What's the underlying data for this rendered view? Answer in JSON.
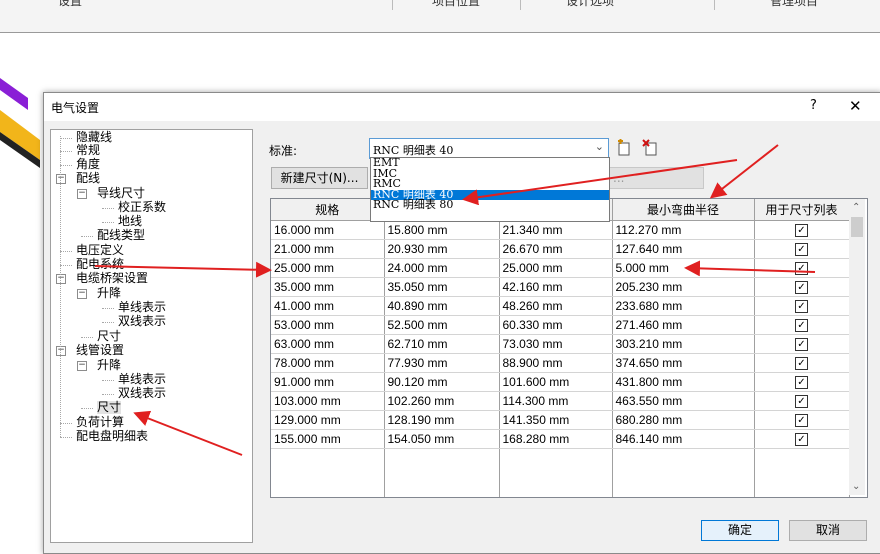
{
  "top_tabs": [
    "设置",
    "项目位置",
    "设计选项",
    "管理项目"
  ],
  "dialog": {
    "title": "电气设置",
    "help_label": "?",
    "close_label": "✕",
    "tree": [
      {
        "label": "隐藏线",
        "toggle": ""
      },
      {
        "label": "常规",
        "toggle": ""
      },
      {
        "label": "角度",
        "toggle": ""
      },
      {
        "label": "配线",
        "toggle": "−"
      },
      {
        "label": "导线尺寸",
        "toggle": "−"
      },
      {
        "label": "校正系数",
        "toggle": ""
      },
      {
        "label": "地线",
        "toggle": ""
      },
      {
        "label": "配线类型",
        "toggle": ""
      },
      {
        "label": "电压定义",
        "toggle": ""
      },
      {
        "label": "配电系统",
        "toggle": ""
      },
      {
        "label": "电缆桥架设置",
        "toggle": "−"
      },
      {
        "label": "升降",
        "toggle": "−"
      },
      {
        "label": "单线表示",
        "toggle": ""
      },
      {
        "label": "双线表示",
        "toggle": ""
      },
      {
        "label": "尺寸",
        "toggle": ""
      },
      {
        "label": "线管设置",
        "toggle": "−"
      },
      {
        "label": "升降",
        "toggle": "−"
      },
      {
        "label": "单线表示",
        "toggle": ""
      },
      {
        "label": "双线表示",
        "toggle": ""
      },
      {
        "label": "尺寸",
        "toggle": "",
        "selected": true
      },
      {
        "label": "负荷计算",
        "toggle": ""
      },
      {
        "label": "配电盘明细表",
        "toggle": ""
      }
    ],
    "standard_label": "标准:",
    "standard_value": "RNC 明细表 40",
    "dropdown_options": [
      "EMT",
      "IMC",
      "RMC",
      "RNC 明细表 40",
      "RNC 明细表 80"
    ],
    "dropdown_selected_index": 3,
    "new_size_button": "新建尺寸(N)...",
    "delete_size_button": "...",
    "table": {
      "headers": [
        "规格",
        "",
        "",
        "最小弯曲半径",
        "用于尺寸列表"
      ],
      "rows": [
        [
          "16.000 mm",
          "15.800 mm",
          "21.340 mm",
          "112.270 mm",
          true
        ],
        [
          "21.000 mm",
          "20.930 mm",
          "26.670 mm",
          "127.640 mm",
          true
        ],
        [
          "25.000 mm",
          "24.000 mm",
          "25.000 mm",
          "5.000 mm",
          true
        ],
        [
          "35.000 mm",
          "35.050 mm",
          "42.160 mm",
          "205.230 mm",
          true
        ],
        [
          "41.000 mm",
          "40.890 mm",
          "48.260 mm",
          "233.680 mm",
          true
        ],
        [
          "53.000 mm",
          "52.500 mm",
          "60.330 mm",
          "271.460 mm",
          true
        ],
        [
          "63.000 mm",
          "62.710 mm",
          "73.030 mm",
          "303.210 mm",
          true
        ],
        [
          "78.000 mm",
          "77.930 mm",
          "88.900 mm",
          "374.650 mm",
          true
        ],
        [
          "91.000 mm",
          "90.120 mm",
          "101.600 mm",
          "431.800 mm",
          true
        ],
        [
          "103.000 mm",
          "102.260 mm",
          "114.300 mm",
          "463.550 mm",
          true
        ],
        [
          "129.000 mm",
          "128.190 mm",
          "141.350 mm",
          "680.280 mm",
          true
        ],
        [
          "155.000 mm",
          "154.050 mm",
          "168.280 mm",
          "846.140 mm",
          true
        ]
      ]
    },
    "check_glyph": "✓",
    "ok_button": "确定",
    "cancel_button": "取消"
  },
  "colors": {
    "accent": "#0078d7",
    "annotation_arrow": "#e02020"
  }
}
